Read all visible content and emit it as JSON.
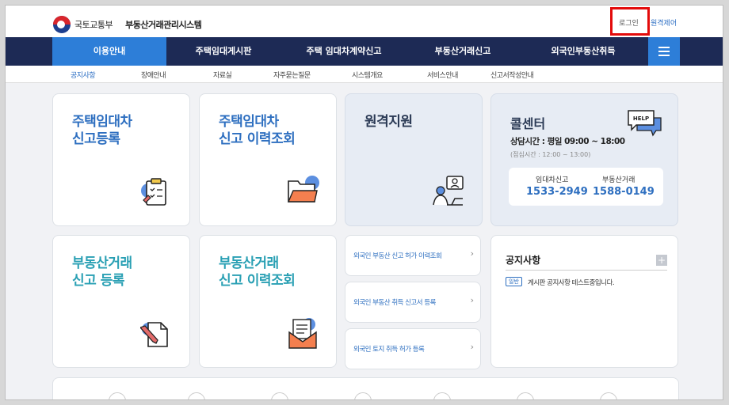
{
  "header": {
    "ministry": "국토교통부",
    "system_name": "부동산거래관리시스템",
    "login": "로그인",
    "remote": "원격제어"
  },
  "nav": {
    "items": [
      "이용안내",
      "주택임대게시판",
      "주택 임대차계약신고",
      "부동산거래신고",
      "외국인부동산취득"
    ],
    "active_index": 0
  },
  "subnav": {
    "items": [
      "공지사항",
      "장애안내",
      "자료실",
      "자주묻는질문",
      "시스템개요",
      "서비스안내",
      "신고서작성안내"
    ]
  },
  "cards": {
    "housing_lease_report": "주택임대차\n신고등록",
    "housing_lease_history": "주택임대차\n신고 이력조회",
    "remote_support": "원격지원",
    "real_estate_report": "부동산거래\n신고 등록",
    "real_estate_history": "부동산거래\n신고 이력조회"
  },
  "call_center": {
    "title": "콜센터",
    "hours": "상담시간 : 평일 09:00 ~ 18:00",
    "lunch": "(점심시간 : 12:00 ~ 13:00)",
    "lease_label": "임대차신고",
    "lease_number": "1533-2949",
    "trade_label": "부동산거래",
    "trade_number": "1588-0149",
    "help_icon_text": "HELP"
  },
  "foreign_links": [
    "외국인 부동산 신고 허가 이력조회",
    "외국인 부동산 취득 신고서 등록",
    "외국인 토지 취득 허가 등록"
  ],
  "notice": {
    "title": "공지사항",
    "plus": "+",
    "badge": "일반",
    "item": "게시판 공지사항 테스트중입니다."
  },
  "colors": {
    "nav_bg": "#1d2a55",
    "accent": "#2d7ed8",
    "title_blue": "#2e6fc0",
    "title_teal": "#2aa0b4",
    "highlight": "#e30b0b"
  }
}
